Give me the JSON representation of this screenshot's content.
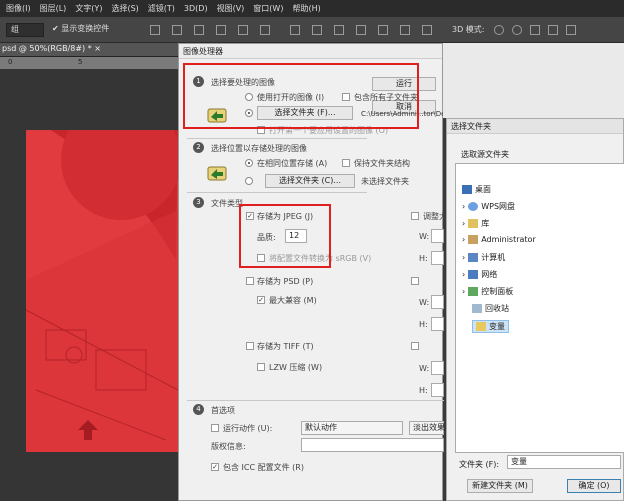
{
  "menu": [
    "图像(I)",
    "图层(L)",
    "文字(Y)",
    "选择(S)",
    "滤镜(T)",
    "3D(D)",
    "视图(V)",
    "窗口(W)",
    "帮助(H)"
  ],
  "options": {
    "select_value": "组",
    "show_transform": "显示变换控件",
    "mode_3d": "3D 模式:"
  },
  "doc_tab": "psd @ 50%(RGB/8#) *  ×",
  "ruler": [
    "0",
    "5"
  ],
  "dialog": {
    "title": "图像处理器",
    "run": "运行",
    "cancel": "取消",
    "s1": {
      "title": "选择要处理的图像",
      "use_open": "使用打开的图像 (I)",
      "include_sub": "包含所有子文件夹",
      "select_folder": "选择文件夹 (F)...",
      "path": "C:\\Users\\Admini...tor\\Desktop\\变量",
      "open_first": "打开第一个要应用设置的图像 (O)"
    },
    "s2": {
      "title": "选择位置以存储处理的图像",
      "same_loc": "在相同位置存储 (A)",
      "keep_struct": "保持文件夹结构",
      "select_folder": "选择文件夹 (C)...",
      "none": "未选择文件夹"
    },
    "s3": {
      "title": "文件类型",
      "save_jpeg": "存储为 JPEG (J)",
      "resize": "调整大",
      "quality_label": "品质:",
      "quality_value": "12",
      "convert_srgb": "将配置文件转换为 sRGB (V)",
      "w": "W:",
      "h": "H:",
      "save_psd": "存储为 PSD (P)",
      "max_compat": "最大兼容 (M)",
      "save_tiff": "存储为 TIFF (T)",
      "lzw": "LZW 压缩 (W)"
    },
    "s4": {
      "title": "首选项",
      "run_action": "运行动作 (U):",
      "action_set": "默认动作",
      "action": "淡出效果",
      "copyright": "版权信息:",
      "include_icc": "包含 ICC 配置文件 (R)"
    }
  },
  "folder": {
    "title": "选择文件夹",
    "prompt": "选取源文件夹",
    "items": [
      "桌面",
      "WPS网盘",
      "库",
      "Administrator",
      "计算机",
      "网络",
      "控制面板",
      "回收站",
      "变量"
    ],
    "folder_label": "文件夹 (F):",
    "folder_value": "变量",
    "new_folder": "新建文件夹 (M)",
    "ok": "确定 (O)"
  }
}
